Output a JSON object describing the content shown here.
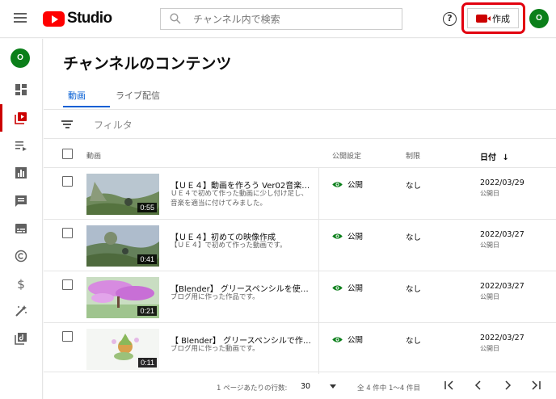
{
  "app": {
    "logo_text": "Studio",
    "search_placeholder": "チャンネル内で検索",
    "create_label": "作成",
    "help_glyph": "?",
    "avatar_letter": "O",
    "brand_color": "#ff0000",
    "highlight_color": "#e2000f"
  },
  "sidebar": {
    "items": [
      {
        "icon": "dashboard-icon",
        "active": false
      },
      {
        "icon": "content-icon",
        "active": true
      },
      {
        "icon": "playlists-icon",
        "active": false
      },
      {
        "icon": "analytics-icon",
        "active": false
      },
      {
        "icon": "comments-icon",
        "active": false
      },
      {
        "icon": "subtitles-icon",
        "active": false
      },
      {
        "icon": "copyright-icon",
        "active": false
      },
      {
        "icon": "monetization-icon",
        "active": false
      },
      {
        "icon": "customization-icon",
        "active": false
      },
      {
        "icon": "audio-library-icon",
        "active": false
      }
    ]
  },
  "main": {
    "title": "チャンネルのコンテンツ",
    "tabs": [
      {
        "label": "動画",
        "active": true
      },
      {
        "label": "ライブ配信",
        "active": false
      }
    ],
    "filter_label": "フィルタ",
    "columns": {
      "video": "動画",
      "visibility": "公開設定",
      "restrictions": "制限",
      "date": "日付",
      "date_sort_glyph": "↓"
    },
    "videos": [
      {
        "title": "【ＵＥ４】動画を作ろう Ver02音楽付…",
        "description": "ＵＥ４で初めて作った動画に少し付け足し、音楽を適当に付けてみました。",
        "duration": "0:55",
        "visibility": "公開",
        "restriction": "なし",
        "date": "2022/03/29",
        "date_label": "公開日"
      },
      {
        "title": "【ＵＥ４】初めての映像作成",
        "description": "【ＵＥ４】で初めて作った動画です。",
        "duration": "0:41",
        "visibility": "公開",
        "restriction": "なし",
        "date": "2022/03/27",
        "date_label": "公開日"
      },
      {
        "title": "【Blender】 グリースペンシルを使っ…",
        "description": "ブログ用に作った作品です。",
        "duration": "0:21",
        "visibility": "公開",
        "restriction": "なし",
        "date": "2022/03/27",
        "date_label": "公開日"
      },
      {
        "title": "【 Blender】 グリースペンシルで作っ…",
        "description": "ブログ用に作った動画です。",
        "duration": "0:11",
        "visibility": "公開",
        "restriction": "なし",
        "date": "2022/03/27",
        "date_label": "公開日"
      }
    ],
    "footer": {
      "rows_per_page_label": "1 ページあたりの行数:",
      "rows_per_page_value": "30",
      "range_text": "全 4 件中 1～4 件目"
    }
  }
}
